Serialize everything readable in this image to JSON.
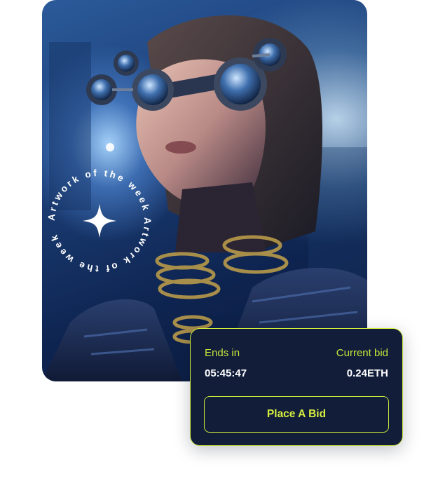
{
  "artwork": {
    "badge_text": "Artwork of the week Artwork of the week ",
    "icon": "sparkle-icon"
  },
  "bid": {
    "ends_label": "Ends in",
    "ends_value": "05:45:47",
    "current_label": "Current bid",
    "current_value": "0.24ETH",
    "button_label": "Place A Bid"
  },
  "colors": {
    "accent": "#c8e63b",
    "card_bg": "#121d3a",
    "text_light": "#ffffff"
  }
}
